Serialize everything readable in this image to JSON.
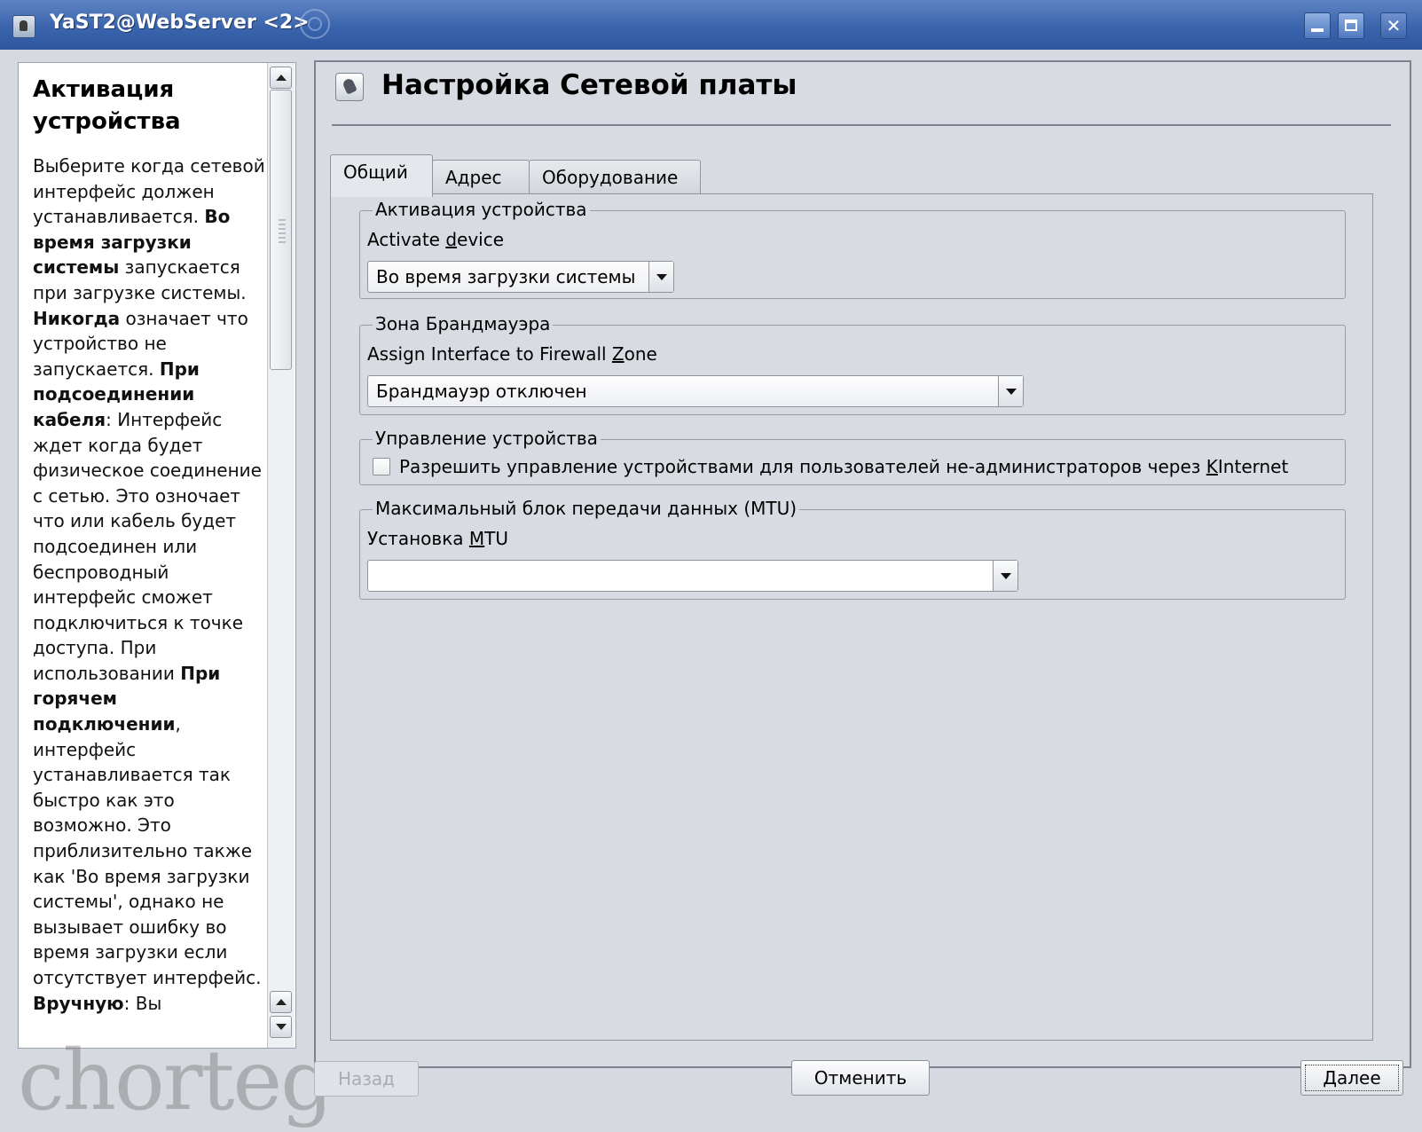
{
  "window": {
    "title": "YaST2@WebServer <2>",
    "buttons": {
      "minimize": "minimize-icon",
      "maximize": "maximize-icon",
      "close": "✕"
    }
  },
  "help": {
    "title": "Активация устройства",
    "parts": [
      {
        "t": "Выберите когда сетевой интерфейс должен устанавливается. "
      },
      {
        "b": "Во время загрузки системы"
      },
      {
        "t": " запускается при загрузке системы. "
      },
      {
        "b": "Никогда"
      },
      {
        "t": " означает что устройство не запускается. "
      },
      {
        "b": "При подсоединении кабеля"
      },
      {
        "t": ": Интерфейс ждет когда будет физическое соединение с сетью. Это озночает что или кабель будет подсоединен или беспроводный интерфейс сможет подключиться к точке доступа. При использовании "
      },
      {
        "b": "При горячем подключении"
      },
      {
        "t": ", интерфейс устанавливается так быстро как это возможно. Это приблизительно также как 'Во время загрузки системы', однако не вызывает ошибку во время загрузки если отсутствует интерфейс. "
      },
      {
        "b": "Вручную"
      },
      {
        "t": ": Вы"
      }
    ],
    "watermark": "chorteg"
  },
  "page": {
    "title": "Настройка Сетевой платы",
    "tabs": [
      "Общий",
      "Адрес",
      "Оборудование"
    ]
  },
  "activation": {
    "legend": "Активация устройства",
    "label_pre": "Activate ",
    "label_ul": "d",
    "label_post": "evice",
    "value": "Во время загрузки системы"
  },
  "firewall": {
    "legend": "Зона Брандмауэра",
    "label_pre": "Assign Interface to Firewall ",
    "label_ul": "Z",
    "label_post": "one",
    "value": "Брандмауэр отключен"
  },
  "control": {
    "legend": "Управление устройства",
    "checkbox_pre": "Разрешить управление устройствами для пользователей не-администраторов через ",
    "checkbox_ul": "K",
    "checkbox_post": "Internet",
    "checked": false
  },
  "mtu": {
    "legend": "Максимальный блок передачи данных (MTU)",
    "label_pre": "Установка ",
    "label_ul": "M",
    "label_post": "TU",
    "value": ""
  },
  "buttons": {
    "back": "Назад",
    "cancel": "Отменить",
    "next": "Далее"
  }
}
